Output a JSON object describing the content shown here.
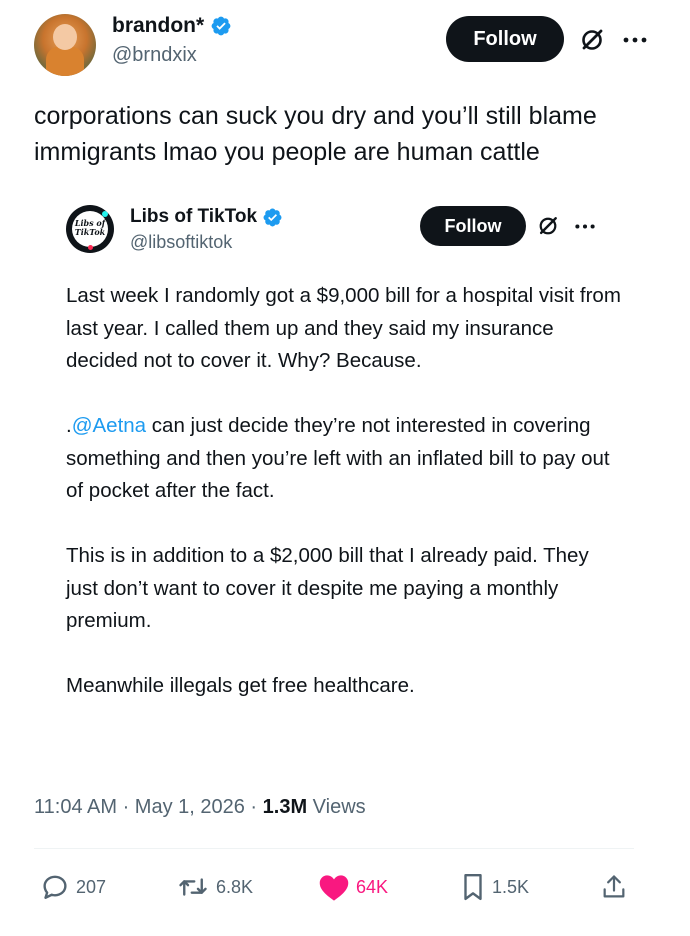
{
  "tweet": {
    "author_name": "brandon*",
    "author_handle": "@brndxix",
    "follow_label": "Follow",
    "text_line1": "corporations can suck you dry and you’ll still blame",
    "text_line2": "immigrants lmao you people are human cattle",
    "timestamp": "11:04 AM · May 1, 2026 · ",
    "views_count": "1.3M",
    "views_label": " Views"
  },
  "quoted": {
    "author_name": "Libs of TikTok",
    "author_handle": "@libsoftiktok",
    "avatar_text_1": "Libs of",
    "avatar_text_2": "TikTok",
    "follow_label": "Follow",
    "para1": "Last week I randomly got a $9,000 bill for a hospital visit from last year. I called them up and they said my insurance decided not to cover it. Why? Because.",
    "para2_prefix": ".",
    "para2_mention": "@Aetna",
    "para2_rest": " can just decide they’re not interested in covering something and then you’re left with an inflated bill to pay out of pocket after the fact.",
    "para3": "This is in addition to a $2,000 bill that I already paid. They just don’t want to cover it despite me paying a monthly premium.",
    "para4": "Meanwhile illegals get free healthcare."
  },
  "actions": {
    "replies": "207",
    "reposts": "6.8K",
    "likes": "64K",
    "bookmarks": "1.5K"
  },
  "colors": {
    "accent": "#1d9bf0",
    "like": "#f91880",
    "text": "#0f1419",
    "secondary": "#536471"
  },
  "icons": [
    "verified-badge-icon",
    "grok-icon",
    "more-icon",
    "reply-icon",
    "repost-icon",
    "like-icon",
    "bookmark-icon",
    "share-icon"
  ]
}
